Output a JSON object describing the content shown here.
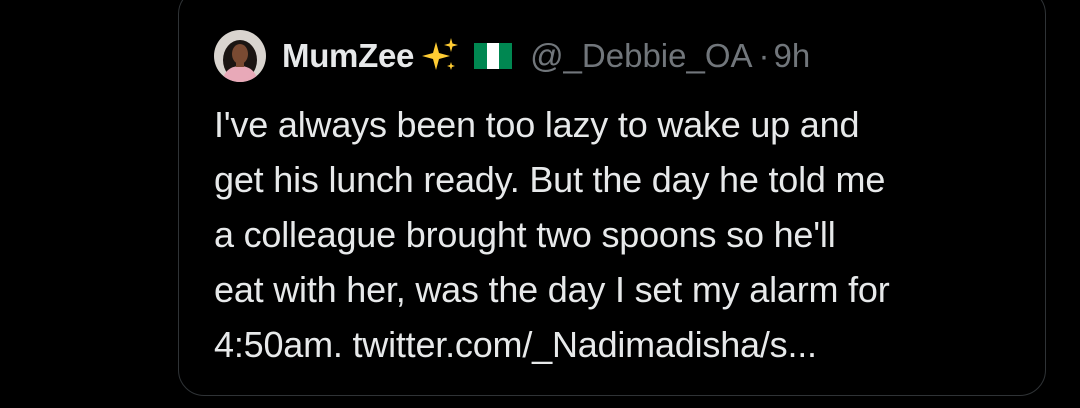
{
  "quoted_tweet": {
    "author": {
      "display_name": "MumZee",
      "name_emoji_icons": [
        "sparkles-icon",
        "nigeria-flag-icon"
      ],
      "handle": "@_Debbie_OA",
      "separator": "·",
      "time": "9h"
    },
    "body_lines": [
      "I've always been too lazy to wake up and",
      "get his lunch ready. But the day he told me",
      "a colleague brought two spoons so he'll",
      "eat with her, was the day I set my alarm for"
    ],
    "last_line_prefix": "4:50am. ",
    "link_text": "twitter.com/_Nadimadisha/s...",
    "colors": {
      "background": "#000000",
      "primary_text": "#e7e9ea",
      "secondary_text": "#71767b",
      "card_border": "#2f3336",
      "flag_green": "#008751",
      "flag_white": "#ffffff",
      "sparkle_yellow": "#ffcc33"
    }
  }
}
